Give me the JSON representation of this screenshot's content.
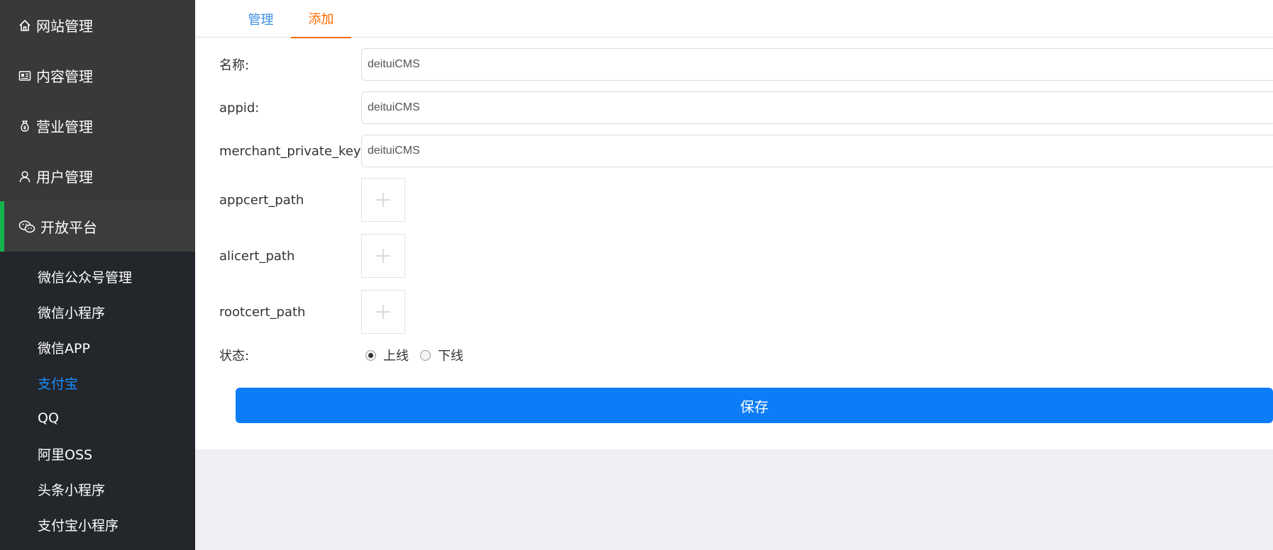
{
  "sidebar": {
    "menu": [
      {
        "label": "网站管理",
        "icon": "home-icon"
      },
      {
        "label": "内容管理",
        "icon": "content-card-icon"
      },
      {
        "label": "营业管理",
        "icon": "money-bag-icon"
      },
      {
        "label": "用户管理",
        "icon": "user-icon"
      },
      {
        "label": "开放平台",
        "icon": "wechat-icon"
      }
    ],
    "active_menu": "开放平台",
    "submenu": [
      {
        "label": "微信公众号管理"
      },
      {
        "label": "微信小程序"
      },
      {
        "label": "微信APP"
      },
      {
        "label": "支付宝"
      },
      {
        "label": "QQ"
      },
      {
        "label": "阿里OSS"
      },
      {
        "label": "头条小程序"
      },
      {
        "label": "支付宝小程序"
      }
    ],
    "current_submenu": "支付宝"
  },
  "tabs": [
    {
      "label": "管理"
    },
    {
      "label": "添加"
    }
  ],
  "active_tab": "添加",
  "form": {
    "name": {
      "label": "名称:",
      "value": "deituiCMS"
    },
    "appid": {
      "label": "appid:",
      "value": "deituiCMS"
    },
    "merchant_private_key": {
      "label": "merchant_private_key",
      "value": "deituiCMS"
    },
    "appcert_path": {
      "label": "appcert_path"
    },
    "alicert_path": {
      "label": "alicert_path"
    },
    "rootcert_path": {
      "label": "rootcert_path"
    },
    "status": {
      "label": "状态:",
      "options": [
        "上线",
        "下线"
      ],
      "selected": "上线"
    }
  },
  "save_label": "保存",
  "colors": {
    "sidebar_bg": "#23262b",
    "top_menu_bg": "#393939",
    "active_indicator": "#16b24a",
    "submenu_current": "#1a8cff",
    "tab_manage": "#3a8ee6",
    "tab_add": "#ff6a00",
    "save_button": "#0d7cf7",
    "page_bg": "#efeff4"
  }
}
